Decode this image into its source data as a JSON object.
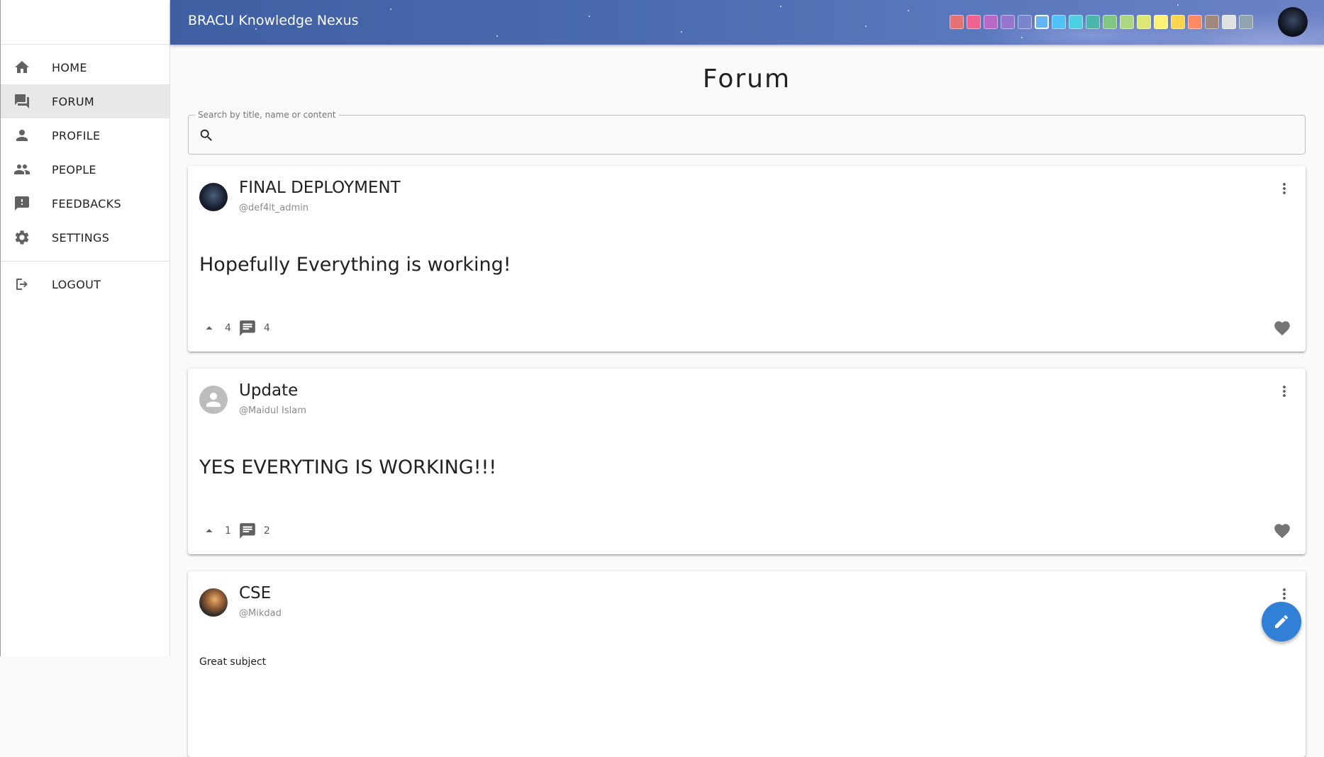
{
  "app": {
    "title": "BRACU Knowledge Nexus"
  },
  "sidebar": {
    "items": [
      {
        "label": "HOME",
        "icon": "home-icon",
        "active": false
      },
      {
        "label": "FORUM",
        "icon": "forum-icon",
        "active": true
      },
      {
        "label": "PROFILE",
        "icon": "person-icon",
        "active": false
      },
      {
        "label": "PEOPLE",
        "icon": "people-icon",
        "active": false
      },
      {
        "label": "FEEDBACKS",
        "icon": "feedback-icon",
        "active": false
      },
      {
        "label": "SETTINGS",
        "icon": "gear-icon",
        "active": false
      }
    ],
    "logout": {
      "label": "LOGOUT",
      "icon": "logout-icon"
    }
  },
  "theme_colors": [
    "#e57373",
    "#f06292",
    "#ba68c8",
    "#9575cd",
    "#7986cb",
    "#64b5f6",
    "#4fc3f7",
    "#4dd0e1",
    "#4db6ac",
    "#81c784",
    "#aed581",
    "#dce775",
    "#fff176",
    "#ffd54f",
    "#ff8a65",
    "#a1887f",
    "#e0e0e0",
    "#90a4ae"
  ],
  "theme_selected_index": 5,
  "main": {
    "title": "Forum",
    "search": {
      "label": "Search by title, name or content",
      "value": ""
    }
  },
  "posts": [
    {
      "title": "FINAL DEPLOYMENT",
      "author": "@def4lt_admin",
      "content": "Hopefully Everything is working!",
      "upvotes": "4",
      "comments": "4"
    },
    {
      "title": "Update",
      "author": "@Maidul Islam",
      "content": "YES EVERYTING IS WORKING!!!",
      "upvotes": "1",
      "comments": "2"
    },
    {
      "title": "CSE",
      "author": "@Mikdad",
      "content": "Great subject"
    }
  ]
}
